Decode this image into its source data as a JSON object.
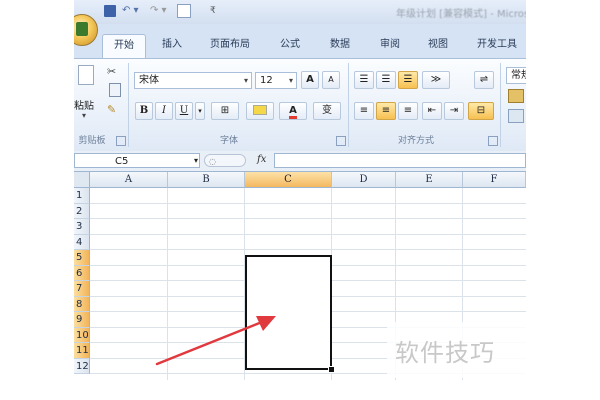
{
  "title_bar": {
    "title": "年级计划 [兼容模式] - Micros",
    "undo_glyph": "↶ ▾",
    "redo_glyph": "↷ ▾",
    "more_glyph": "₹"
  },
  "ribbon_tabs": [
    {
      "label": "开始",
      "active": true
    },
    {
      "label": "插入",
      "active": false
    },
    {
      "label": "页面布局",
      "active": false
    },
    {
      "label": "公式",
      "active": false
    },
    {
      "label": "数据",
      "active": false
    },
    {
      "label": "审阅",
      "active": false
    },
    {
      "label": "视图",
      "active": false
    },
    {
      "label": "开发工具",
      "active": false
    }
  ],
  "clipboard": {
    "paste_label": "粘贴",
    "group_label": "剪贴板"
  },
  "font": {
    "font_name": "宋体",
    "font_size": "12",
    "grow_label": "A",
    "shrink_label": "A",
    "bold": "B",
    "italic": "I",
    "underline": "U",
    "font_color_label": "A",
    "wen_label": "变",
    "group_label": "字体"
  },
  "alignment": {
    "group_label": "对齐方式"
  },
  "number": {
    "format_label": "常规"
  },
  "formula_bar": {
    "name_box": "C5",
    "fx_label": "fx",
    "formula": ""
  },
  "grid": {
    "columns": [
      "A",
      "B",
      "C",
      "D",
      "E",
      "F"
    ],
    "selected_column": "C",
    "rows": [
      "1",
      "2",
      "3",
      "4",
      "5",
      "6",
      "7",
      "8",
      "9",
      "10",
      "11",
      "12"
    ],
    "selected_rows": [
      "5",
      "6",
      "7",
      "8",
      "9",
      "10",
      "11"
    ]
  },
  "watermark": {
    "text": "软件技巧"
  },
  "colors": {
    "accent": "#f4b861",
    "arrow": "#e0393e",
    "ribbon_bg": "#dfe9f6"
  }
}
